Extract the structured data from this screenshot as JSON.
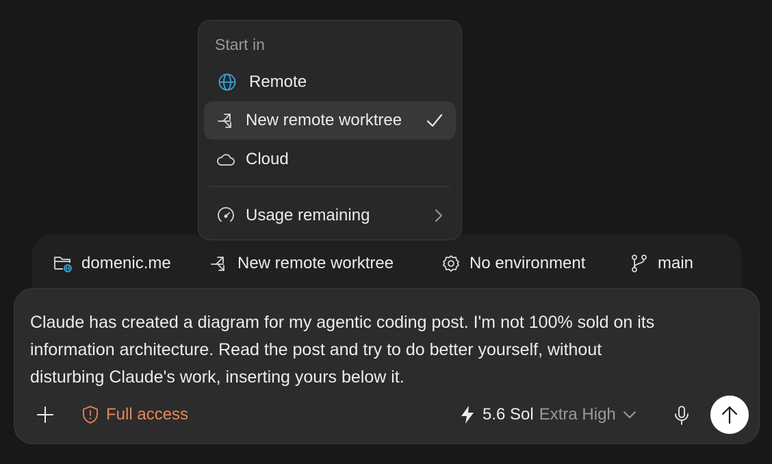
{
  "menu": {
    "heading": "Start in",
    "items": [
      {
        "label": "Remote",
        "icon": "globe-icon"
      },
      {
        "label": "New remote worktree",
        "icon": "worktree-icon",
        "selected": true
      },
      {
        "label": "Cloud",
        "icon": "cloud-icon"
      },
      {
        "label": "Usage remaining",
        "icon": "gauge-icon"
      }
    ]
  },
  "context_bar": {
    "project": "domenic.me",
    "worktree": "New remote worktree",
    "environment": "No environment",
    "branch": "main"
  },
  "composer": {
    "prompt": "Claude has created a diagram for my agentic coding post. I'm not 100% sold on its\ninformation architecture. Read the post and try to do better yourself, without\ndisturbing Claude's work, inserting yours below it.",
    "access_label": "Full access",
    "model_name": "5.6 Sol",
    "model_effort": "Extra High"
  },
  "colors": {
    "background": "#181818",
    "menu_bg": "#282828",
    "composer_bg": "#2c2c2c",
    "accent_orange": "#e8865a",
    "globe_blue": "#3aa6d8"
  }
}
